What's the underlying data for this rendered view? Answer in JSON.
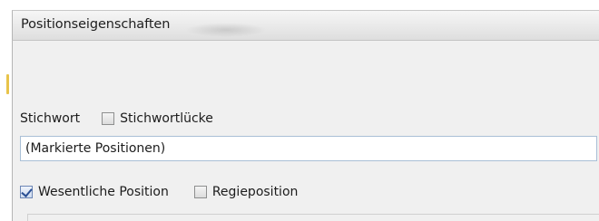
{
  "window": {
    "title": "Positionseigenschaften"
  },
  "form": {
    "stichwort_label": "Stichwort",
    "stichwortluecke_label": "Stichwortlücke",
    "stichwortluecke_checked": false,
    "stichwort_value": "(Markierte Positionen)",
    "wesentliche_label": "Wesentliche Position",
    "wesentliche_checked": true,
    "regie_label": "Regieposition",
    "regie_checked": false
  }
}
